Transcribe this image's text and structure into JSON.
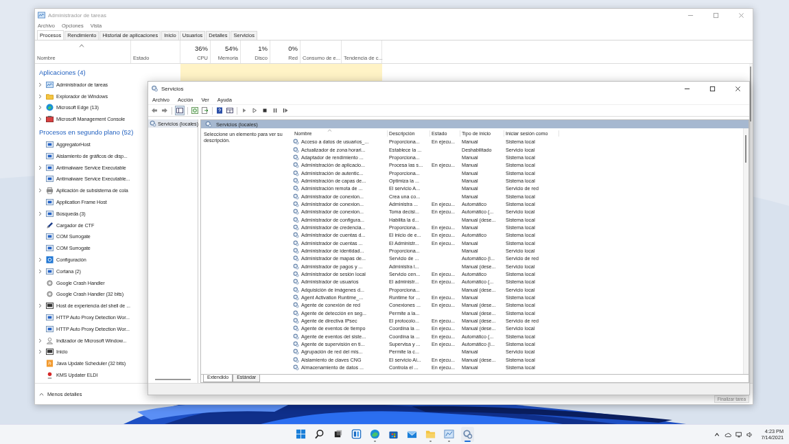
{
  "task_manager": {
    "title": "Administrador de tareas",
    "menu": [
      "Archivo",
      "Opciones",
      "Vista"
    ],
    "tabs": [
      {
        "label": "Procesos",
        "selected": true
      },
      {
        "label": "Rendimiento",
        "selected": false
      },
      {
        "label": "Historial de aplicaciones",
        "selected": false
      },
      {
        "label": "Inicio",
        "selected": false
      },
      {
        "label": "Usuarios",
        "selected": false
      },
      {
        "label": "Detalles",
        "selected": false
      },
      {
        "label": "Servicios",
        "selected": false
      }
    ],
    "columns": [
      {
        "label": "Nombre"
      },
      {
        "label": "Estado"
      },
      {
        "label": "CPU",
        "reading": "36%"
      },
      {
        "label": "Memoria",
        "reading": "54%"
      },
      {
        "label": "Disco",
        "reading": "1%"
      },
      {
        "label": "Red",
        "reading": "0%"
      },
      {
        "label": "Consumo de e..."
      },
      {
        "label": "Tendencia de c..."
      }
    ],
    "groups": [
      {
        "title": "Aplicaciones (4)",
        "processes": [
          {
            "name": "Administrador de tareas",
            "kind": "taskmgr",
            "has_children": true
          },
          {
            "name": "Explorador de Windows",
            "kind": "folder",
            "has_children": true
          },
          {
            "name": "Microsoft Edge (13)",
            "kind": "edge",
            "has_children": true
          },
          {
            "name": "Microsoft Management Console",
            "kind": "mmc",
            "has_children": true
          }
        ]
      },
      {
        "title": "Procesos en segundo plano (52)",
        "processes": [
          {
            "name": "AggregatorHost",
            "kind": "app",
            "has_children": false
          },
          {
            "name": "Aislamiento de gráficos de disp...",
            "kind": "app",
            "has_children": false
          },
          {
            "name": "Antimalware Service Executable",
            "kind": "app",
            "has_children": true
          },
          {
            "name": "Antimalware Service Executable...",
            "kind": "app",
            "has_children": false
          },
          {
            "name": "Aplicación de subsistema de cola",
            "kind": "printer",
            "has_children": true
          },
          {
            "name": "Application Frame Host",
            "kind": "app",
            "has_children": false
          },
          {
            "name": "Búsqueda (3)",
            "kind": "app",
            "has_children": true
          },
          {
            "name": "Cargador de CTF",
            "kind": "pen",
            "has_children": false
          },
          {
            "name": "COM Surrogate",
            "kind": "app",
            "has_children": false
          },
          {
            "name": "COM Surrogate",
            "kind": "app",
            "has_children": false
          },
          {
            "name": "Configuración",
            "kind": "gear",
            "has_children": true
          },
          {
            "name": "Cortana (2)",
            "kind": "app",
            "has_children": true
          },
          {
            "name": "Google Crash Handler",
            "kind": "crash",
            "has_children": false
          },
          {
            "name": "Google Crash Handler (32 bits)",
            "kind": "crash",
            "has_children": false
          },
          {
            "name": "Host de experiencia del shell de ...",
            "kind": "monitor",
            "has_children": true
          },
          {
            "name": "HTTP Auto Proxy Detection Wor...",
            "kind": "app",
            "has_children": false
          },
          {
            "name": "HTTP Auto Proxy Detection Wor...",
            "kind": "app",
            "has_children": false
          },
          {
            "name": "Indizador de Microsoft Window...",
            "kind": "user",
            "has_children": true
          },
          {
            "name": "Inicio",
            "kind": "monitor",
            "has_children": true
          },
          {
            "name": "Java Update Scheduler (32 bits)",
            "kind": "java",
            "has_children": false
          },
          {
            "name": "KMS Updater ELDI",
            "kind": "kms",
            "has_children": false
          }
        ]
      }
    ],
    "less_details": "Menos detalles",
    "end_task": "Finalizar tarea"
  },
  "services_window": {
    "title": "Servicios",
    "menu": [
      "Archivo",
      "Acción",
      "Ver",
      "Ayuda"
    ],
    "tree": [
      {
        "label": "Servicios (locales)",
        "selected": true
      }
    ],
    "panel_title": "Servicios (locales)",
    "description_hint": "Seleccione un elemento para ver su descripción.",
    "columns": [
      "Nombre",
      "Descripción",
      "Estado",
      "Tipo de inicio",
      "Iniciar sesión como"
    ],
    "rows": [
      {
        "name": "Acceso a datos de usuarios_...",
        "description": "Proporciona...",
        "status": "En ejecu...",
        "startup": "Manual",
        "logon": "Sistema local"
      },
      {
        "name": "Actualizador de zona horari...",
        "description": "Establece la ...",
        "startup": "Deshabilitado",
        "logon": "Servicio local"
      },
      {
        "name": "Adaptador de rendimiento ...",
        "description": "Proporciona...",
        "startup": "Manual",
        "logon": "Sistema local"
      },
      {
        "name": "Administración de aplicacio...",
        "description": "Procesa las s...",
        "status": "En ejecu...",
        "startup": "Manual",
        "logon": "Sistema local"
      },
      {
        "name": "Administración de autentic...",
        "description": "Proporciona...",
        "startup": "Manual",
        "logon": "Sistema local"
      },
      {
        "name": "Administración de capas de...",
        "description": "Optimiza la ...",
        "startup": "Manual",
        "logon": "Sistema local"
      },
      {
        "name": "Administración remota de ...",
        "description": "El servicio A...",
        "startup": "Manual",
        "logon": "Servicio de red"
      },
      {
        "name": "Administrador de conexion...",
        "description": "Crea una co...",
        "startup": "Manual",
        "logon": "Sistema local"
      },
      {
        "name": "Administrador de conexion...",
        "description": "Administra ...",
        "status": "En ejecu...",
        "startup": "Automático",
        "logon": "Sistema local"
      },
      {
        "name": "Administrador de conexion...",
        "description": "Toma decisi...",
        "status": "En ejecu...",
        "startup": "Automático (...",
        "logon": "Servicio local"
      },
      {
        "name": "Administrador de configura...",
        "description": "Habilita la d...",
        "startup": "Manual (dese...",
        "logon": "Sistema local"
      },
      {
        "name": "Administrador de credencia...",
        "description": "Proporciona...",
        "status": "En ejecu...",
        "startup": "Manual",
        "logon": "Sistema local"
      },
      {
        "name": "Administrador de cuentas d...",
        "description": "El inicio de e...",
        "status": "En ejecu...",
        "startup": "Automático",
        "logon": "Sistema local"
      },
      {
        "name": "Administrador de cuentas ...",
        "description": "El Administr...",
        "status": "En ejecu...",
        "startup": "Manual",
        "logon": "Sistema local"
      },
      {
        "name": "Administrador de identidad...",
        "description": "Proporciona...",
        "startup": "Manual",
        "logon": "Servicio local"
      },
      {
        "name": "Administrador de mapas de...",
        "description": "Servicio de ...",
        "startup": "Automático (i...",
        "logon": "Servicio de red"
      },
      {
        "name": "Administrador de pagos y ...",
        "description": "Administra l...",
        "startup": "Manual (dese...",
        "logon": "Servicio local"
      },
      {
        "name": "Administrador de sesión local",
        "description": "Servicio cen...",
        "status": "En ejecu...",
        "startup": "Automático",
        "logon": "Sistema local"
      },
      {
        "name": "Administrador de usuarios",
        "description": "El administr...",
        "status": "En ejecu...",
        "startup": "Automático (...",
        "logon": "Sistema local"
      },
      {
        "name": "Adquisición de imágenes d...",
        "description": "Proporciona...",
        "startup": "Manual (dese...",
        "logon": "Servicio local"
      },
      {
        "name": "Agent Activation Runtime_...",
        "description": "Runtime for ...",
        "status": "En ejecu...",
        "startup": "Manual",
        "logon": "Sistema local"
      },
      {
        "name": "Agente de conexión de red",
        "description": "Conexiones ...",
        "status": "En ejecu...",
        "startup": "Manual (dese...",
        "logon": "Sistema local"
      },
      {
        "name": "Agente de detección en seg...",
        "description": "Permite a la...",
        "startup": "Manual (dese...",
        "logon": "Sistema local"
      },
      {
        "name": "Agente de directiva IPsec",
        "description": "El protocolo...",
        "status": "En ejecu...",
        "startup": "Manual (dese...",
        "logon": "Servicio de red"
      },
      {
        "name": "Agente de eventos de tiempo",
        "description": "Coordina la ...",
        "status": "En ejecu...",
        "startup": "Manual (dese...",
        "logon": "Servicio local"
      },
      {
        "name": "Agente de eventos del siste...",
        "description": "Coordina la ...",
        "status": "En ejecu...",
        "startup": "Automático (...",
        "logon": "Sistema local"
      },
      {
        "name": "Agente de supervisión en ti...",
        "description": "Supervisa y ...",
        "status": "En ejecu...",
        "startup": "Automático (i...",
        "logon": "Sistema local"
      },
      {
        "name": "Agrupación de red del mis...",
        "description": "Permite la c...",
        "startup": "Manual",
        "logon": "Servicio local"
      },
      {
        "name": "Aislamiento de claves CNG",
        "description": "El servicio Ai...",
        "status": "En ejecu...",
        "startup": "Manual (dese...",
        "logon": "Sistema local"
      },
      {
        "name": "Almacenamiento de datos ...",
        "description": "Controla el ...",
        "status": "En ejecu...",
        "startup": "Manual",
        "logon": "Sistema local"
      }
    ],
    "tabs": [
      {
        "label": "Extendido",
        "selected": true
      },
      {
        "label": "Estándar",
        "selected": false
      }
    ]
  },
  "taskbar": {
    "apps": [
      {
        "kind": "start",
        "running": false,
        "selected": false
      },
      {
        "kind": "search",
        "running": false,
        "selected": false
      },
      {
        "kind": "taskview",
        "running": false,
        "selected": false
      },
      {
        "kind": "widgets",
        "running": false,
        "selected": false
      },
      {
        "kind": "edge",
        "running": true,
        "selected": false
      },
      {
        "kind": "store",
        "running": false,
        "selected": false
      },
      {
        "kind": "mail",
        "running": false,
        "selected": false
      },
      {
        "kind": "folder",
        "running": true,
        "selected": false
      },
      {
        "kind": "taskmgr",
        "running": true,
        "selected": false
      },
      {
        "kind": "services",
        "running": true,
        "selected": true
      }
    ],
    "time": "4:23 PM",
    "date": "7/14/2021"
  }
}
